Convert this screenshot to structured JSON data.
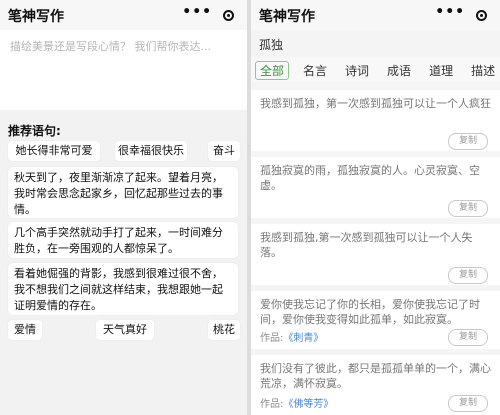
{
  "left": {
    "title": "笔神写作",
    "menu_icon": "more-dots-icon",
    "target_icon": "target-icon",
    "input_placeholder": "描绘美景还是写段心情？ 我们帮你表达...",
    "recommend_title": "推荐语句:",
    "chips_row1": [
      "她长得非常可爱",
      "很幸福很快乐",
      "奋斗"
    ],
    "cards": [
      "秋天到了，夜里渐渐凉了起来。望着月亮，我时常会思念起家乡，回忆起那些过去的事情。",
      "几个高手突然就动手打了起来，一时间难分胜负，在一旁围观的人都惊呆了。",
      "看着她倔强的背影，我感到很难过很不舍，我不想我们之间就这样结束，我想跟她一起证明爱情的存在。"
    ],
    "chips_row2": [
      "爱情",
      "天气真好",
      "桃花"
    ]
  },
  "right": {
    "title": "笔神写作",
    "menu_icon": "more-dots-icon",
    "target_icon": "target-icon",
    "search_value": "孤独",
    "tabs": [
      "全部",
      "名言",
      "诗词",
      "成语",
      "道理",
      "描述"
    ],
    "active_tab": "全部",
    "accent_color": "#3a8f3e",
    "copy_label": "复制",
    "work_label": "作品:",
    "results": [
      {
        "text": "我感到孤独，第一次感到孤独可以让一个人疯狂",
        "work": ""
      },
      {
        "text": "孤独寂寞的雨，孤独寂寞的人。心灵寂寞、空虚。",
        "work": ""
      },
      {
        "text": "我感到孤独,第一次感到孤独可以让一个人失落。",
        "work": ""
      },
      {
        "text": "爱你使我忘记了你的长相，爱你使我忘记了时间，爱你使我变得如此孤单，如此寂寞。",
        "work": "《刺青》"
      },
      {
        "text": "我们没有了彼此，都只是孤孤单单的一个，满心荒凉，满怀寂寞。",
        "work": "《佛等芳》"
      }
    ]
  }
}
